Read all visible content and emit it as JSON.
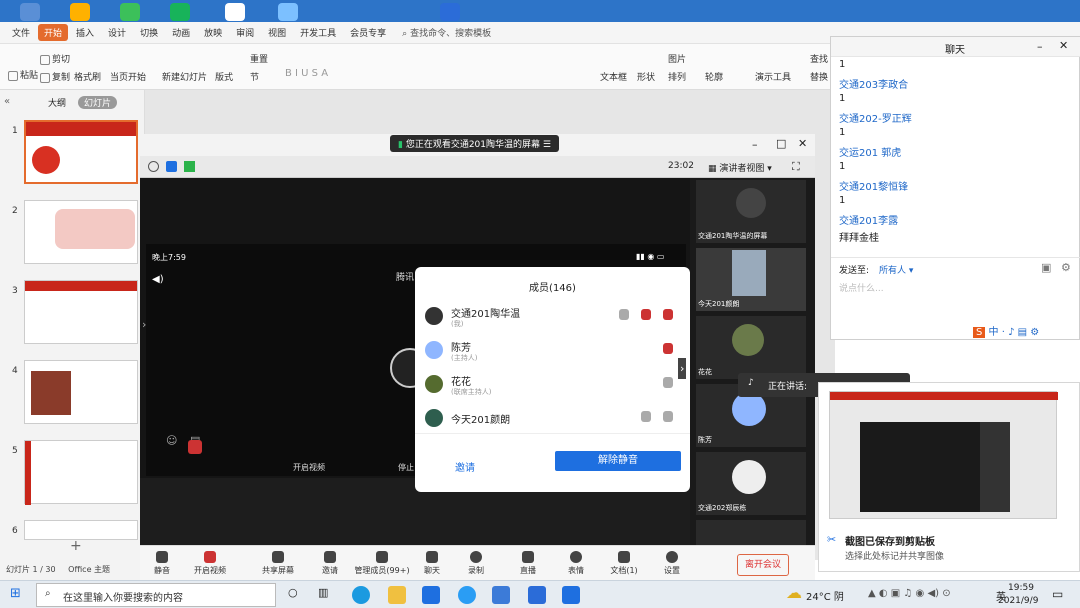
{
  "ribbon": {
    "file": "文件",
    "tabs": [
      "开始",
      "插入",
      "设计",
      "切换",
      "动画",
      "放映",
      "审阅",
      "视图",
      "开发工具",
      "会员专享"
    ],
    "search": "查找命令、搜索模板",
    "tools": [
      "粘贴",
      "剪切",
      "复制",
      "格式刷",
      "当页开始",
      "新建幻灯片",
      "版式",
      "节",
      "重置",
      "文本框",
      "形状",
      "图片",
      "排列",
      "轮廓",
      "演示工具",
      "替换",
      "查找"
    ]
  },
  "panel": {
    "outline_tab": "大纲",
    "slides_tab": "幻灯片",
    "slide_numbers": [
      "1",
      "2",
      "3",
      "4",
      "5",
      "6"
    ]
  },
  "statusbar": {
    "slide_count": "幻灯片 1 / 30",
    "theme": "Office 主题"
  },
  "meeting": {
    "banner": "您正在观看交通201陶华温的屏幕",
    "timer": "23:02",
    "view_mode": "演讲者视图",
    "phone_time": "晚上7:59",
    "phone_title": "腾讯",
    "members": {
      "title": "成员(146)",
      "list": [
        {
          "name": "交通201陶华温",
          "role": "(我)"
        },
        {
          "name": "陈芳",
          "role": "(主持人)"
        },
        {
          "name": "花花",
          "role": "(联席主持人)"
        },
        {
          "name": "今天201颜朗",
          "role": ""
        }
      ],
      "invite": "邀请",
      "unmute_all": "解除静音"
    },
    "stage_labels": {
      "video": "开启视频",
      "stop": "停止"
    },
    "participants": [
      "交通201陶华温的屏幕",
      "今天201颜朗",
      "花花",
      "陈芳",
      "交通202郑辰栋"
    ],
    "speaking": "正在讲话:",
    "bottom": [
      "静音",
      "开启视频",
      "共享屏幕",
      "邀请",
      "管理成员(99+)",
      "聊天",
      "录制",
      "直播",
      "表情",
      "文档(1)",
      "设置"
    ],
    "leave": "离开会议"
  },
  "chat": {
    "title": "聊天",
    "lines": [
      {
        "text": "1",
        "style": "dark"
      },
      {
        "text": "交通203李政合",
        "style": "blue"
      },
      {
        "text": "1",
        "style": "dark"
      },
      {
        "text": "交通202-罗正辉",
        "style": "blue"
      },
      {
        "text": "1",
        "style": "dark"
      },
      {
        "text": "交运201 郭虎",
        "style": "blue"
      },
      {
        "text": "1",
        "style": "dark"
      },
      {
        "text": "交通201黎恒锋",
        "style": "blue"
      },
      {
        "text": "1",
        "style": "dark"
      },
      {
        "text": "交通201李露",
        "style": "blue"
      },
      {
        "text": "拜拜金桂",
        "style": "dark"
      }
    ],
    "send_to_label": "发送至:",
    "send_to_value": "所有人",
    "input_placeholder": "说点什么..."
  },
  "notification": {
    "title": "截图已保存到剪贴板",
    "body": "选择此处标记并共享图像"
  },
  "taskbar": {
    "search_placeholder": "在这里输入你要搜索的内容",
    "weather": "24°C 阴",
    "time": "19:59",
    "date": "2021/9/9",
    "ime": "英"
  },
  "colors": {
    "accent": "#e46b2d",
    "meeting_blue": "#1e6fe0",
    "chat_blue": "#1e67c8",
    "slide_red": "#c8261a"
  }
}
